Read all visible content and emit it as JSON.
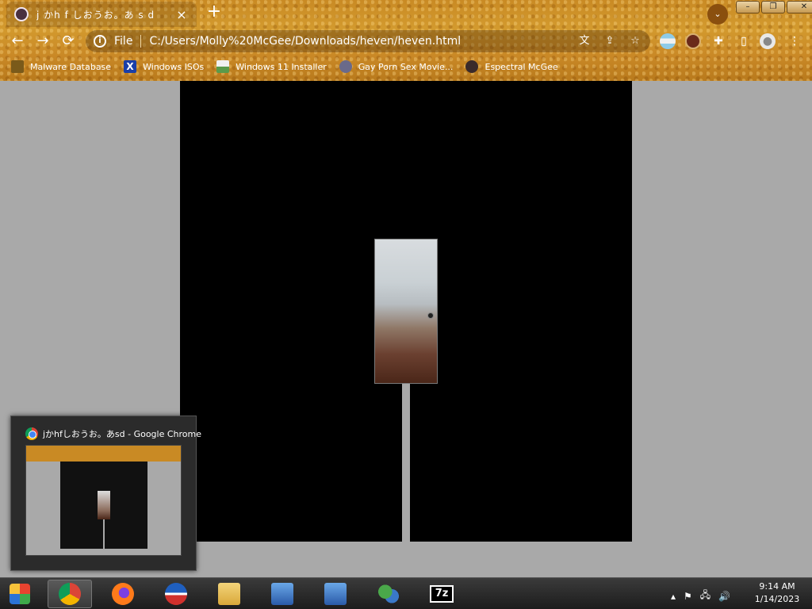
{
  "browser": {
    "tab": {
      "title": "j かh f しおうお。あ s d",
      "close": "×"
    },
    "new_tab": "+",
    "tab_search": "⌄",
    "window_buttons": {
      "minimize": "–",
      "maximize": "❐",
      "close": "✕"
    },
    "toolbar": {
      "back": "←",
      "forward": "→",
      "reload": "⟳",
      "info": "i",
      "scheme": "File",
      "url": "C:/Users/Molly%20McGee/Downloads/heven/heven.html",
      "translate_icon": "文",
      "share_icon": "⇪",
      "star_icon": "☆",
      "extensions_icon": "✚",
      "sidepanel_icon": "▯",
      "profile_icon": "●",
      "menu_icon": "⋮"
    },
    "bookmarks": [
      {
        "label": "Malware Database",
        "icon": "malware-icon",
        "color": "#7a5a1a"
      },
      {
        "label": "Windows ISOs",
        "icon": "windows-x-icon",
        "color": "#1a3fa8"
      },
      {
        "label": "Windows 11 Installer",
        "icon": "installer-icon",
        "color": "#5a9a4a"
      },
      {
        "label": "Gay Porn Sex Movie...",
        "icon": "globe-icon",
        "color": "#6a6a8a"
      },
      {
        "label": "Espectral McGee",
        "icon": "avatar-icon",
        "color": "#3a2a2a"
      }
    ]
  },
  "preview": {
    "title": "jかhfしおうお。あsd - Google Chrome"
  },
  "taskbar": {
    "apps": [
      {
        "name": "chrome",
        "active": true,
        "color": "#db4437"
      },
      {
        "name": "firefox",
        "active": false,
        "color": "#ff7a1a"
      },
      {
        "name": "obama",
        "active": false,
        "color": "#1f5fbf"
      },
      {
        "name": "file-explorer",
        "active": false,
        "color": "#e8c25a"
      },
      {
        "name": "installer-1",
        "active": false,
        "color": "#3a78c8"
      },
      {
        "name": "installer-2",
        "active": false,
        "color": "#3a78c8"
      },
      {
        "name": "network-people",
        "active": false,
        "color": "#4aa84a"
      },
      {
        "name": "7zip",
        "active": false,
        "label": "7z",
        "color": "#000000"
      }
    ],
    "tray": {
      "arrow": "▴",
      "flag": "⚑",
      "network": "🖧",
      "volume": "🔊"
    },
    "clock": {
      "time": "9:14 AM",
      "date": "1/14/2023"
    }
  },
  "colors": {
    "chrome_theme": "#c98a24",
    "page_background": "#a9a9a9",
    "canvas_black": "#000000"
  }
}
